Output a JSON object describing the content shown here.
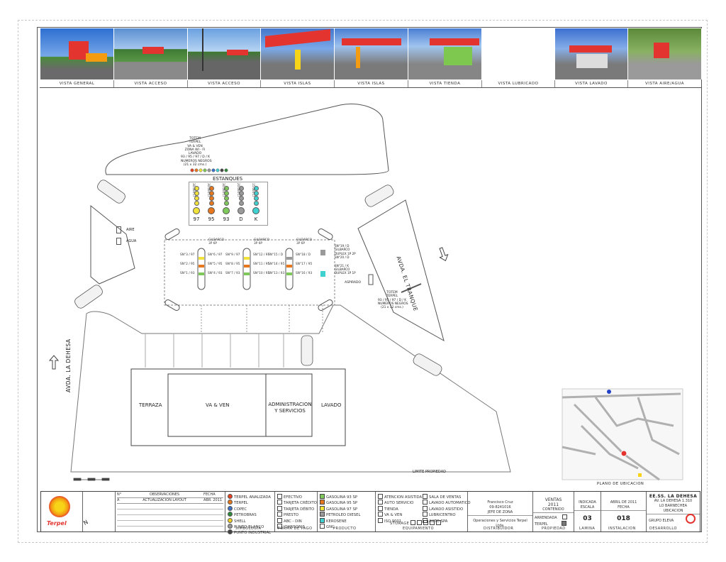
{
  "photos": {
    "captions": [
      "VISTA GENERAL",
      "VISTA ACCESO",
      "VISTA ACCESO",
      "VISTA ISLAS",
      "VISTA ISLAS",
      "VISTA TIENDA",
      "VISTA LUBRICADO",
      "VISTA LAVADO",
      "VISTA AIRE/AGUA"
    ]
  },
  "plan": {
    "totem_top": [
      "TOTEM",
      "TERPEL",
      "VA & VEN",
      "ZONA WI - FI",
      "LAVADO",
      "93 / 95 / 97 / D / K",
      "NUMEROS NEGROS",
      "(21 x 32 cms.)"
    ],
    "estanques_title": "ESTANQUES",
    "tanks": [
      {
        "fuel": "97",
        "capacity": "30.000 LT",
        "color": "#f2e33a"
      },
      {
        "fuel": "95",
        "capacity": "30.000 LT",
        "color": "#e8781e"
      },
      {
        "fuel": "93",
        "capacity": "30.000 LT",
        "color": "#7fc85a"
      },
      {
        "fuel": "D",
        "capacity": "20.000 LT",
        "color": "#9a9a9a"
      },
      {
        "fuel": "K",
        "capacity": "15.000 LT",
        "color": "#3fd0d0"
      }
    ],
    "aire": "AIRE",
    "agua": "AGUA",
    "avda_tranque": "AVDA. EL TRANQUE",
    "avda_dehesa": "AVDA. LA DEHESA",
    "dispenser_head": [
      "GILBARCO",
      "3P 6P"
    ],
    "islands": [
      {
        "left": [
          "SN°3 / 97",
          "SN°2 / 95",
          "SN°1 / 93"
        ],
        "right": [
          "SN°6 / 97",
          "SN°5 / 95",
          "SN°4 / 93"
        ]
      },
      {
        "left": [
          "SN°9 / 97",
          "SN°8 / 95",
          "SN°7 / 93"
        ],
        "right": [
          "SN°12 / 97",
          "SN°11 / 95",
          "SN°10 / 93"
        ]
      },
      {
        "left": [
          "SN°15 / D",
          "SN°14 / 95",
          "SN°13 / 93"
        ],
        "right": [
          "SN°18 / D",
          "SN°17 / 95",
          "SN°16 / 93"
        ]
      }
    ],
    "duplex": [
      "SN°19 / D",
      "GILBARCO",
      "DUPLEX 1P 2P",
      "SN°20 / D",
      "SN°21 / K",
      "GILBARCO",
      "DUPLEX 1P 1P"
    ],
    "aspirado": "ASPIRADO",
    "totem_right": [
      "TOTEM",
      "TERPEL",
      "93 / 95 / 97 / D / K",
      "NUMEROS NEGROS",
      "(21 x 32 cms.)"
    ],
    "rooms": [
      "TERRAZA",
      "VA & VEN",
      "ADMINISTRACION Y SERVICIOS",
      "LAVADO"
    ],
    "limite": "LIMITE PROPIEDAD",
    "plano_ubicacion": "PLANO DE UBICACION"
  },
  "titleblock": {
    "brand": "Terpel",
    "revisions_header": [
      "N°",
      "OBSERVACIONES",
      "FECHA"
    ],
    "revision_row": [
      "A",
      "ACTUALIZACION LAYOUT",
      "ABR. 2011"
    ],
    "simbologia": [
      "TERPEL ANALIZADA",
      "TERPEL",
      "COPEC",
      "PETROBRAS",
      "SHELL",
      "PUNTO BLANCO",
      "PUNTO INDUSTRIAL"
    ],
    "simbologia_colors": [
      "#e8401e",
      "#e8781e",
      "#3b6fc8",
      "#2e8b3e",
      "#f2d21e",
      "#999999",
      "#444444"
    ],
    "forma_pago": [
      "EFECTIVO",
      "TARJETA CRÉDITO",
      "TARJETA DÉBITO",
      "PRESTO",
      "ABC - DIN",
      "JOHNSON'S"
    ],
    "producto": [
      "GASOLINA 93 SP",
      "GASOLINA 95 SP",
      "GASOLINA 97 SP",
      "PETROLEO DIESEL",
      "KEROSENE",
      "GNC"
    ],
    "producto_colors": [
      "#7fc85a",
      "#e8781e",
      "#f2e33a",
      "#9a9a9a",
      "#3fd0d0",
      "#ffffff"
    ],
    "equipamiento_a": [
      "ATENCION ASISTIDA",
      "AUTO SERVICIO",
      "TIENDA",
      "VA & VEN",
      "ISO 9001"
    ],
    "equipamiento_b": [
      "SALA DE VENTAS",
      "LAVADO AUTOMATICO",
      "LAVADO ASISTIDO",
      "LUBRICENTRO",
      "AUTO SPA"
    ],
    "storage": "STORAGE",
    "jefe_name": "Francisco Cruz",
    "jefe_phone": "09-8241016",
    "jefe_role": "JEFE DE ZONA",
    "distribuidor": "Operaciones y Servicios Terpel Ltda.",
    "ventas": [
      "VENTAS",
      "2011"
    ],
    "contenido": "CONTENIDO",
    "propiedad_a": "ARRENDADA",
    "propiedad_b": "TERPEL",
    "escala_val": "INDICADA",
    "lamina": "03",
    "fecha": "ABRIL DE 2011",
    "instalacion": "018",
    "station": [
      "EE.SS. LA DEHESA",
      "AV. LA DEHESA 1.310",
      "LO BARNECHEA"
    ],
    "ubicacion": "UBICACION",
    "desarrollo": "GRUPO ELEVA",
    "labels": {
      "simbologia": "SIMBOLOGIA",
      "forma": "FORMA DE PAGO",
      "producto": "PRODUCTO",
      "equipamiento": "EQUIPAMIENTO",
      "distribuidor": "DISTRIBUIDOR",
      "propiedad": "PROPIEDAD",
      "escala": "ESCALA",
      "lamina": "LAMINA",
      "fecha": "FECHA",
      "instalacion": "INSTALACION",
      "desarrollo": "DESARROLLO"
    }
  },
  "colors": {
    "terpel_red": "#e3342f",
    "terpel_orange": "#f39c12",
    "terpel_yellow": "#f7d417"
  }
}
